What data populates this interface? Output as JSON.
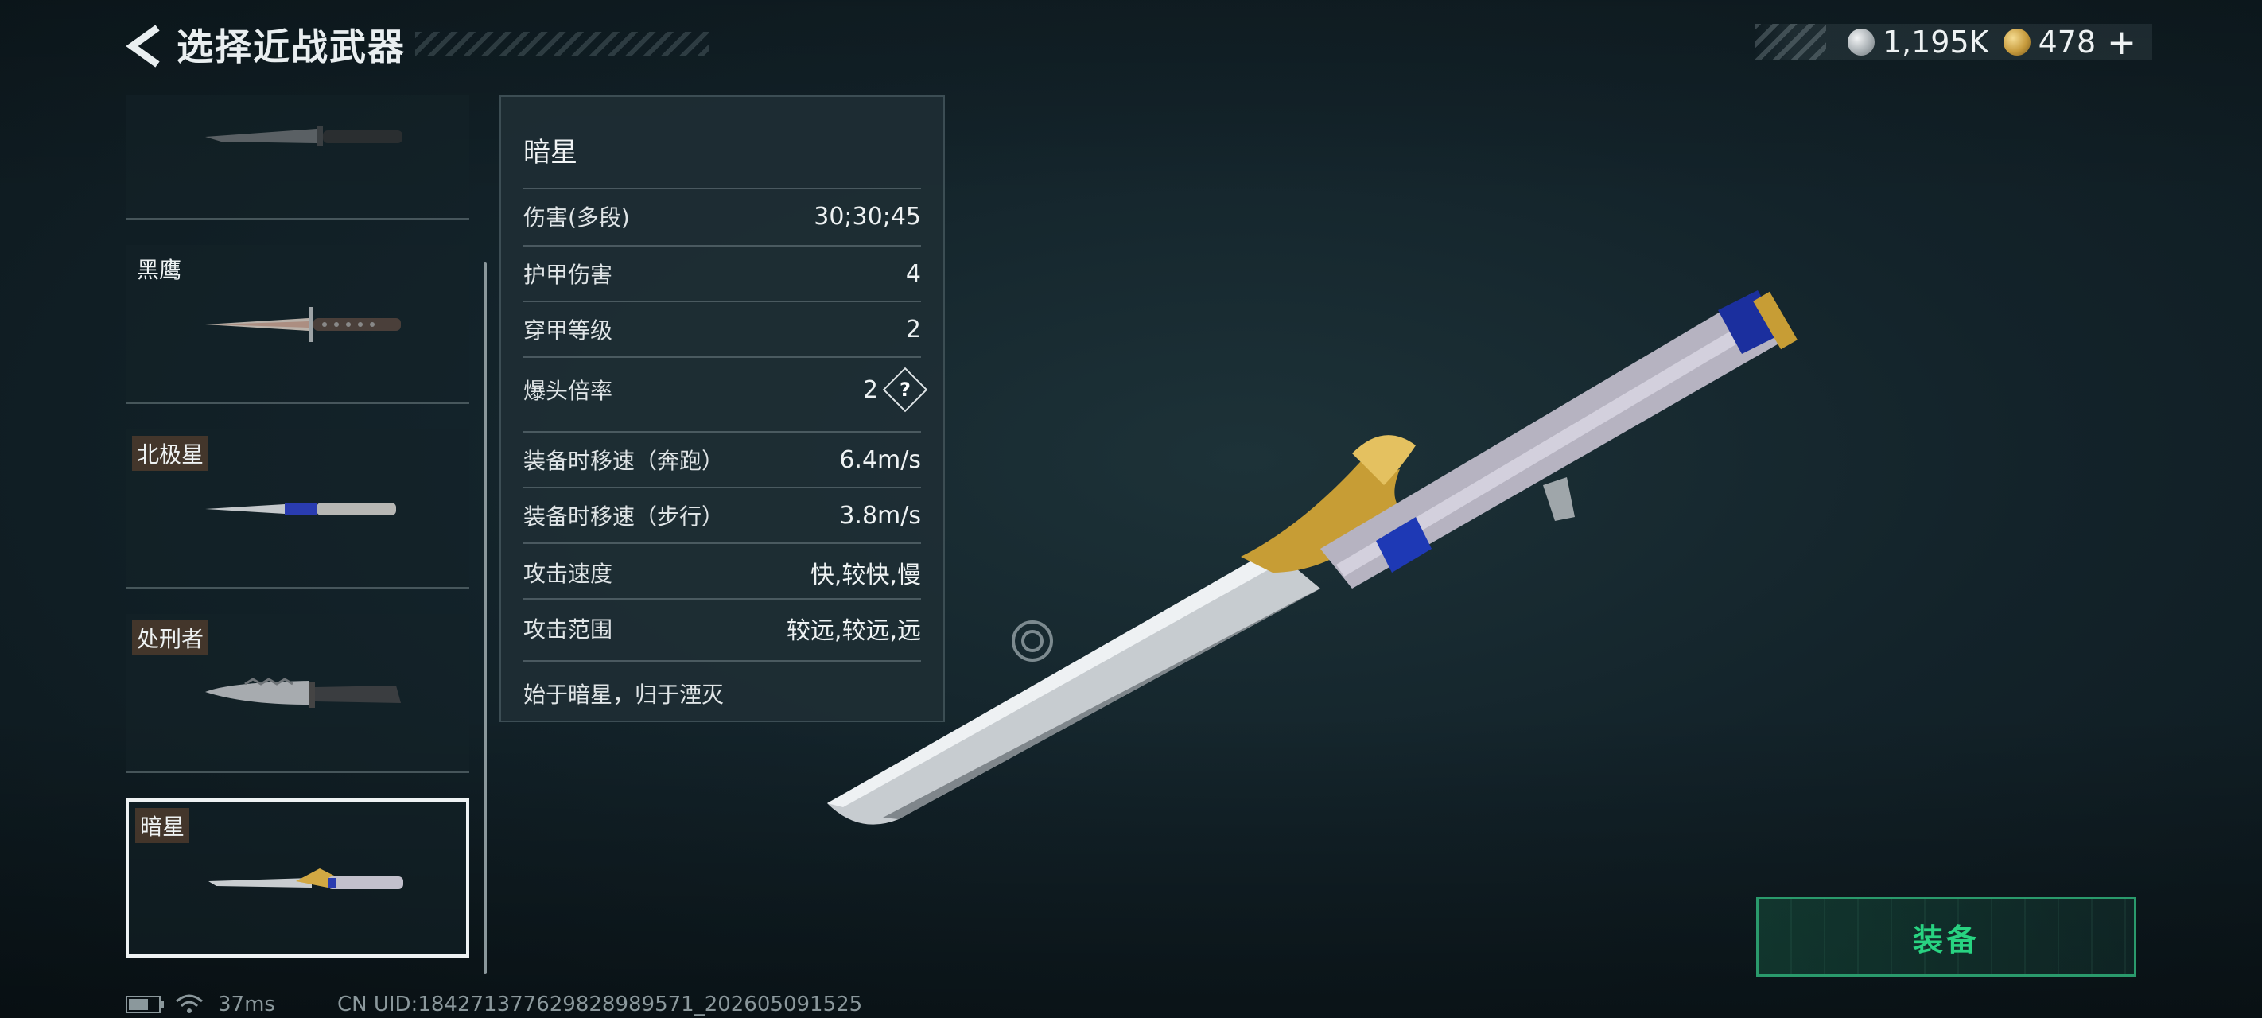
{
  "header": {
    "title": "选择近战武器"
  },
  "currency": {
    "silver_amount": "1,195K",
    "gold_amount": "478",
    "plus_symbol": "+"
  },
  "weapon_list": [
    {
      "name": "",
      "selected": false
    },
    {
      "name": "黑鹰",
      "selected": false
    },
    {
      "name": "北极星",
      "selected": false
    },
    {
      "name": "处刑者",
      "selected": false
    },
    {
      "name": "暗星",
      "selected": true
    }
  ],
  "stats": {
    "title": "暗星",
    "rows": [
      {
        "label": "伤害(多段)",
        "value": "30;30;45"
      },
      {
        "label": "护甲伤害",
        "value": "4"
      },
      {
        "label": "穿甲等级",
        "value": "2"
      },
      {
        "label": "爆头倍率",
        "value": "2"
      },
      {
        "label": "装备时移速（奔跑）",
        "value": "6.4m/s"
      },
      {
        "label": "装备时移速（步行）",
        "value": "3.8m/s"
      },
      {
        "label": "攻击速度",
        "value": "快,较快,慢"
      },
      {
        "label": "攻击范围",
        "value": "较远,较远,远"
      }
    ],
    "help_symbol": "?",
    "description": "始于暗星，归于湮灭"
  },
  "equip": {
    "label": "装备"
  },
  "footer": {
    "ping": "37ms",
    "uid": "CN UID:184271377629828989571_202605091525",
    "battery_level": 0.6
  }
}
